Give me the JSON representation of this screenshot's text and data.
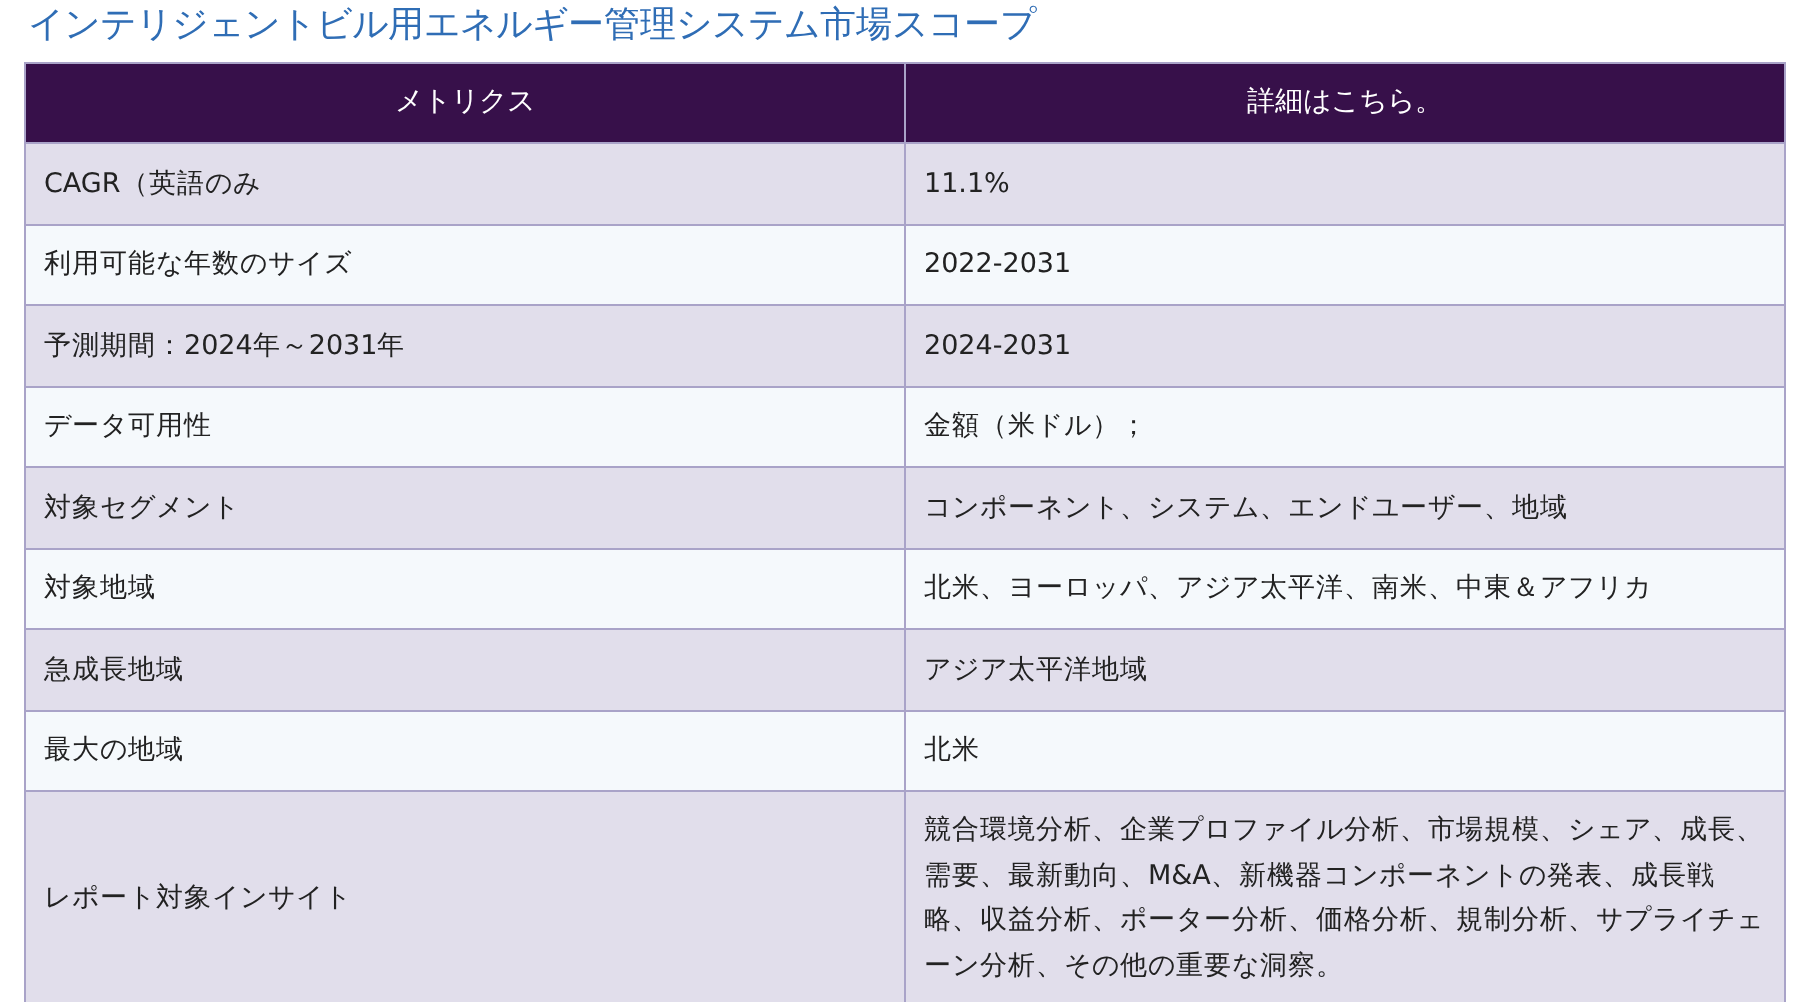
{
  "title": "インテリジェントビル用エネルギー管理システム市場スコープ",
  "table": {
    "columns": [
      "メトリクス",
      "詳細はこちら。"
    ],
    "rows": [
      [
        "CAGR（英語のみ",
        "11.1%"
      ],
      [
        "利用可能な年数のサイズ",
        "2022-2031"
      ],
      [
        "予測期間：2024年～2031年",
        "2024-2031"
      ],
      [
        "データ可用性",
        "金額（米ドル）；"
      ],
      [
        "対象セグメント",
        "コンポーネント、システム、エンドユーザー、地域"
      ],
      [
        "対象地域",
        "北米、ヨーロッパ、アジア太平洋、南米、中東＆アフリカ"
      ],
      [
        "急成長地域",
        "アジア太平洋地域"
      ],
      [
        "最大の地域",
        "北米"
      ],
      [
        "レポート対象インサイト",
        "競合環境分析、企業プロファイル分析、市場規模、シェア、成長、需要、最新動向、M&A、新機器コンポーネントの発表、成長戦略、収益分析、ポーター分析、価格分析、規制分析、サプライチェーン分析、その他の重要な洞察。"
      ]
    ]
  }
}
